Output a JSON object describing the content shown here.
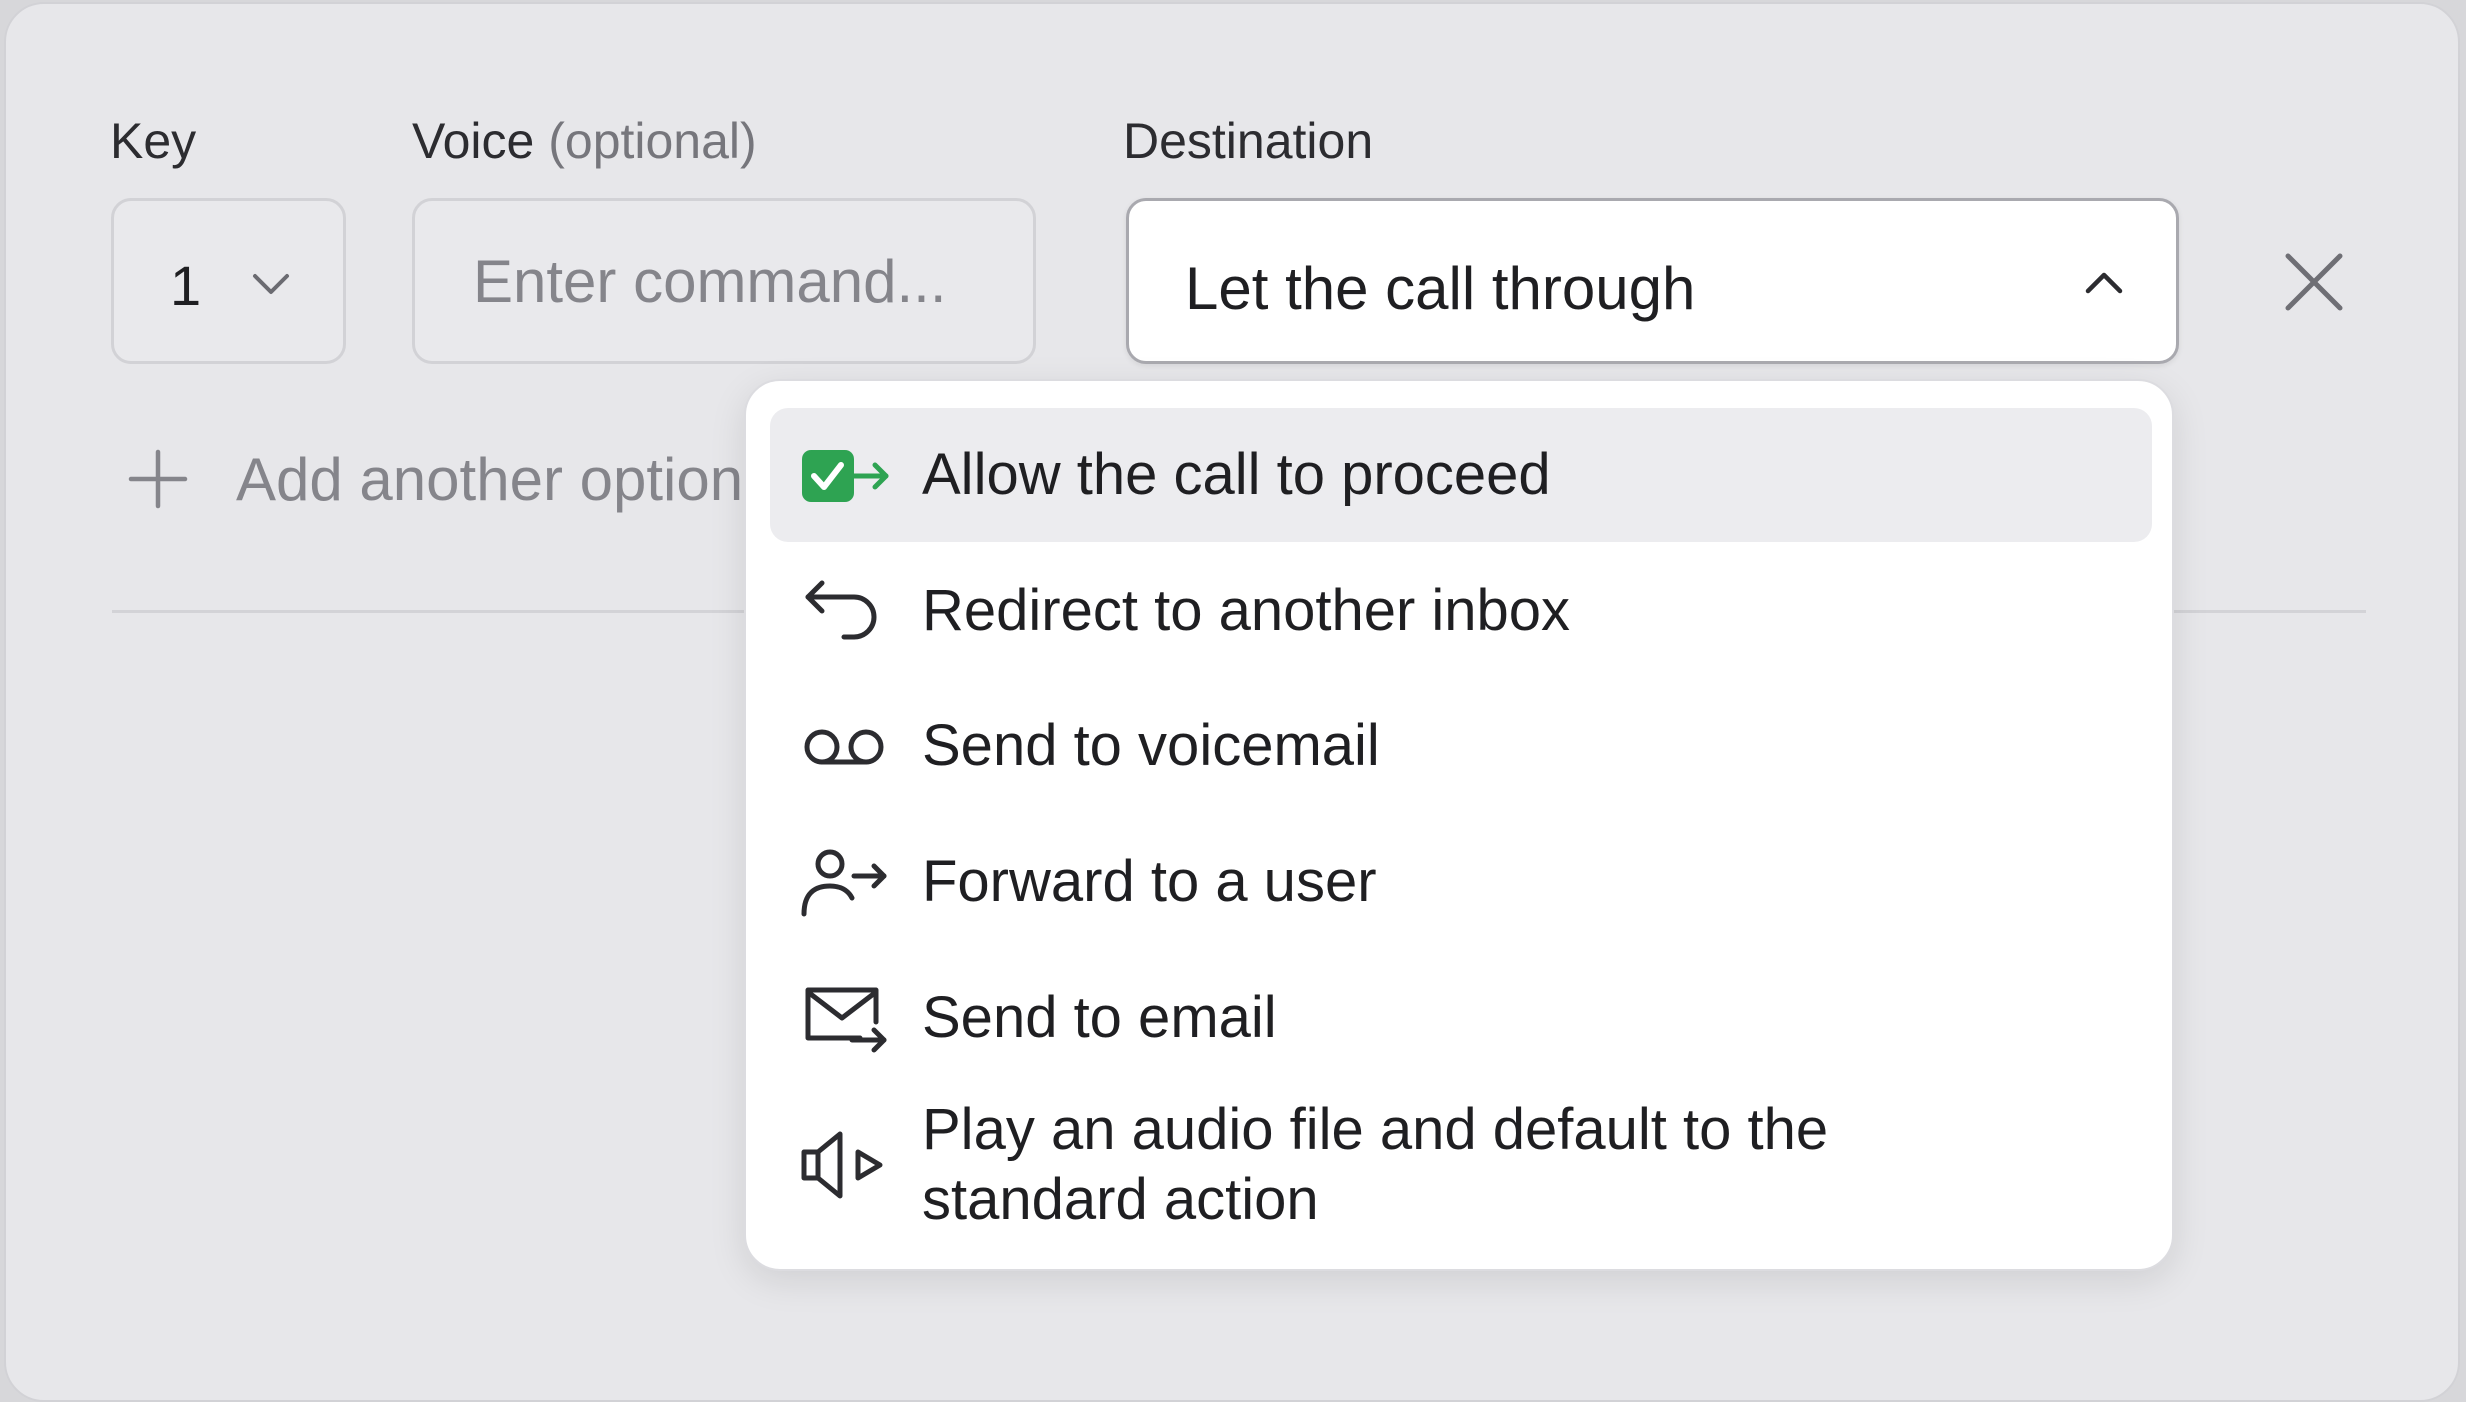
{
  "labels": {
    "key": "Key",
    "voice": "Voice",
    "voice_optional": "(optional)",
    "destination": "Destination"
  },
  "key_select": {
    "value": "1"
  },
  "voice_input": {
    "placeholder": "Enter command..."
  },
  "destination_select": {
    "value": "Let the call through"
  },
  "add_option": {
    "label": "Add another option"
  },
  "dropdown": {
    "options": [
      {
        "label": "Allow the call to proceed",
        "icon": "check-arrow-icon",
        "selected": true
      },
      {
        "label": "Redirect to another inbox",
        "icon": "redirect-arrow-icon",
        "selected": false
      },
      {
        "label": "Send to voicemail",
        "icon": "voicemail-icon",
        "selected": false
      },
      {
        "label": "Forward to a user",
        "icon": "user-forward-icon",
        "selected": false
      },
      {
        "label": "Send to email",
        "icon": "mail-forward-icon",
        "selected": false
      },
      {
        "label": "Play an audio file and default to the standard action",
        "icon": "speaker-play-icon",
        "selected": false
      }
    ]
  },
  "colors": {
    "accent_green": "#2ea352",
    "background": "#e7e7ea",
    "selected_option": "#ececef"
  }
}
